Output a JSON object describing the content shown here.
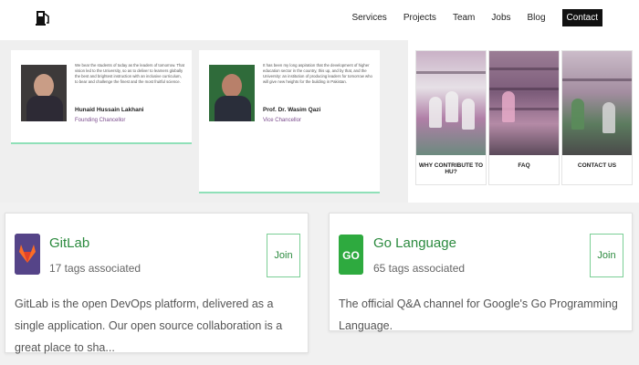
{
  "nav": {
    "items": [
      "Services",
      "Projects",
      "Team",
      "Jobs",
      "Blog"
    ],
    "contact": "Contact"
  },
  "leaders": [
    {
      "text": "We bear the students of today as the leaders of tomorrow. That vision led to the University, so as to deliver to learners globally the best and brightest instruction with an inclusive curriculum, to bear and challenge the finest and the most fruitful science.",
      "name": "Hunaid Hussain Lakhani",
      "role": "Founding Chancellor"
    },
    {
      "text": "It has been my long aspiration that the development of higher education sector in the country, this up, and by that, and the University: an institution of producing leaders for tomorrow who will give new heights for the building in Pakistan.",
      "name": "Prof. Dr. Wasim Qazi",
      "role": "Vice Chancellor"
    }
  ],
  "tiles": [
    {
      "label": "WHY CONTRIBUTE TO HU?"
    },
    {
      "label": "FAQ"
    },
    {
      "label": "CONTACT US"
    }
  ],
  "channels": [
    {
      "title": "GitLab",
      "tags": "17 tags associated",
      "desc": "GitLab is the open DevOps platform, delivered as a single application. Our open source collaboration is a great place to sha...",
      "join": "Join",
      "logo_color": "#554488"
    },
    {
      "title": "Go Language",
      "tags": "65 tags associated",
      "desc": "The official Q&A channel for Google's Go Programming Language.",
      "join": "Join",
      "logo_color": "#2eaa3f",
      "logo_text": "GO"
    }
  ],
  "colors": {
    "accent_green": "#2b8a3e",
    "border_mint": "#8fe0b8",
    "role_purple": "#7a4b8c"
  },
  "icons": {
    "logo": "fuel-pump-icon",
    "gitlab": "gitlab-fox-icon",
    "golang": "go-gopher-icon"
  }
}
